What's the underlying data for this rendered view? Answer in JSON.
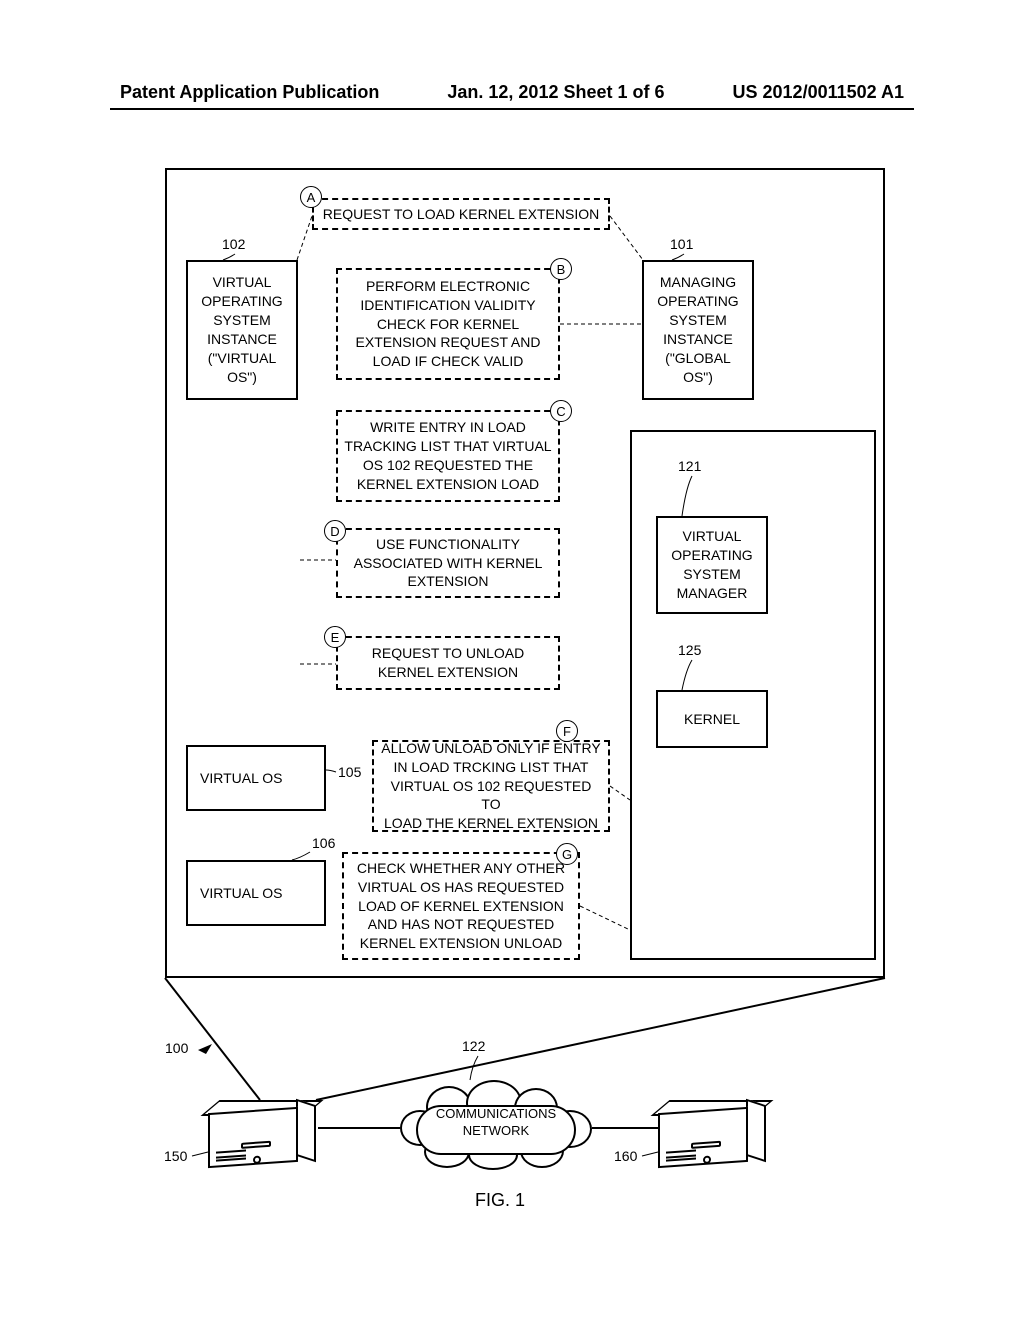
{
  "header": {
    "left": "Patent Application Publication",
    "center": "Jan. 12, 2012  Sheet 1 of 6",
    "right": "US 2012/0011502 A1"
  },
  "refs": {
    "r100": "100",
    "r101": "101",
    "r102": "102",
    "r105": "105",
    "r106": "106",
    "r121": "121",
    "r122": "122",
    "r125": "125",
    "r150": "150",
    "r160": "160"
  },
  "boxes": {
    "virtual_os_main": "VIRTUAL\nOPERATING\nSYSTEM\nINSTANCE\n(\"VIRTUAL OS\")",
    "global_os": "MANAGING\nOPERATING\nSYSTEM\nINSTANCE\n(\"GLOBAL OS\")",
    "vos_manager": "VIRTUAL\nOPERATING\nSYSTEM\nMANAGER",
    "kernel": "KERNEL",
    "virtual_os_105": "VIRTUAL OS",
    "virtual_os_106": "VIRTUAL OS"
  },
  "steps": {
    "A": {
      "badge": "A",
      "text": "REQUEST TO LOAD KERNEL EXTENSION"
    },
    "B": {
      "badge": "B",
      "text": "PERFORM ELECTRONIC\nIDENTIFICATION VALIDITY\nCHECK FOR KERNEL\nEXTENSION REQUEST AND\nLOAD IF CHECK VALID"
    },
    "C": {
      "badge": "C",
      "text": "WRITE ENTRY IN LOAD\nTRACKING LIST THAT VIRTUAL\nOS 102 REQUESTED THE\nKERNEL EXTENSION LOAD"
    },
    "D": {
      "badge": "D",
      "text": "USE FUNCTIONALITY\nASSOCIATED WITH KERNEL\nEXTENSION"
    },
    "E": {
      "badge": "E",
      "text": "REQUEST TO UNLOAD\nKERNEL EXTENSION"
    },
    "F": {
      "badge": "F",
      "text": "ALLOW UNLOAD ONLY IF ENTRY\nIN LOAD TRCKING LIST THAT\nVIRTUAL OS 102 REQUESTED TO\nLOAD THE KERNEL EXTENSION"
    },
    "G": {
      "badge": "G",
      "text": "CHECK WHETHER ANY OTHER\nVIRTUAL OS HAS REQUESTED\nLOAD OF KERNEL EXTENSION\nAND HAS NOT REQUESTED\nKERNEL EXTENSION UNLOAD"
    }
  },
  "network": {
    "cloud": "COMMUNICATIONS\nNETWORK"
  },
  "figure": "FIG. 1"
}
